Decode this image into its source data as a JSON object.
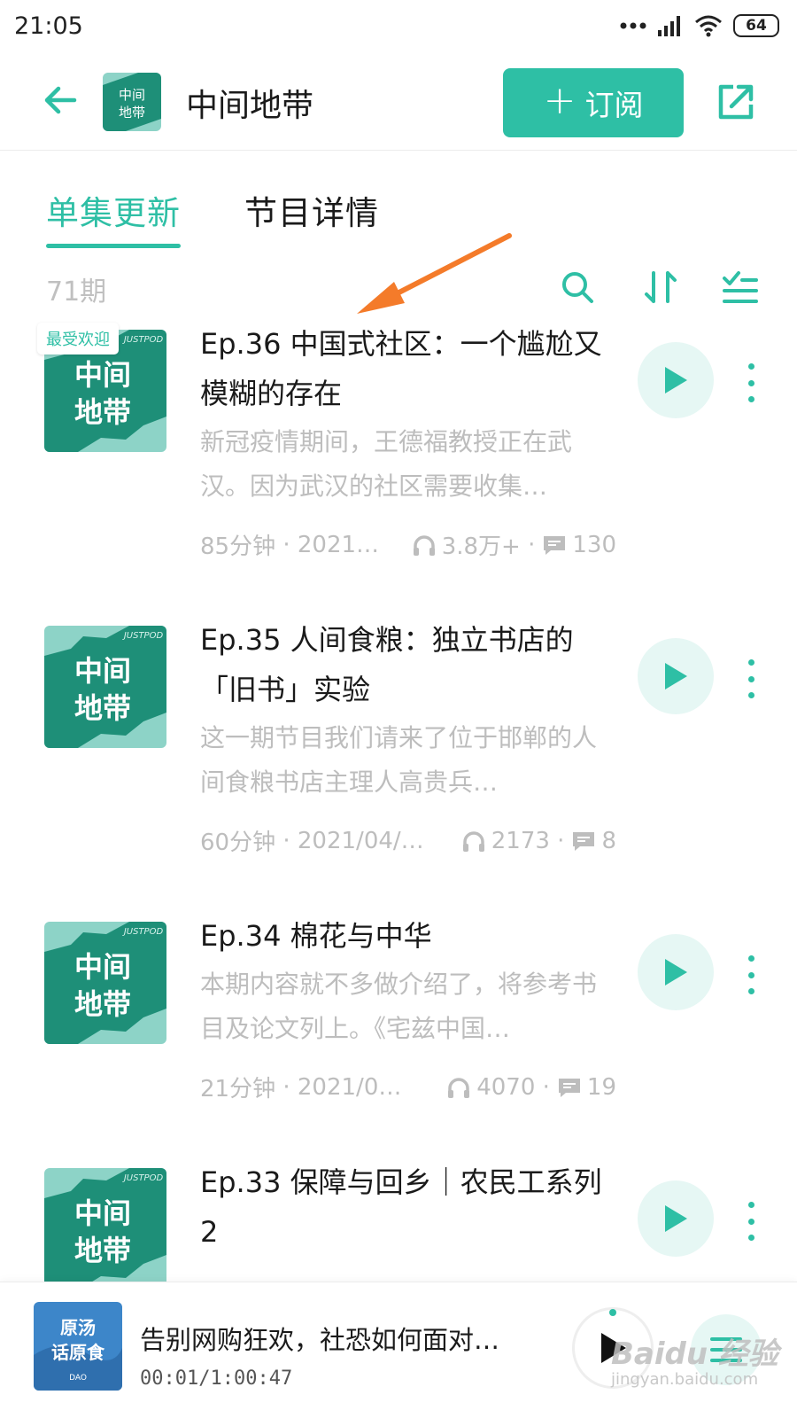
{
  "status_bar": {
    "time": "21:05",
    "battery": "64"
  },
  "header": {
    "title": "中间地带",
    "subscribe_label": "订阅",
    "cover_text_line1": "中间",
    "cover_text_line2": "地带"
  },
  "tabs": [
    {
      "label": "单集更新",
      "active": true
    },
    {
      "label": "节目详情",
      "active": false
    }
  ],
  "toolbar": {
    "episode_count": "71期"
  },
  "episodes": [
    {
      "badge": "最受欢迎",
      "title": "Ep.36 中国式社区：一个尴尬又模糊的存在",
      "description": "新冠疫情期间，王德福教授正在武汉。因为武汉的社区需要收集…",
      "duration": "85分钟",
      "date": "2021…",
      "plays": "3.8万+",
      "comments": "130"
    },
    {
      "badge": "",
      "title": "Ep.35 人间食粮：独立书店的「旧书」实验",
      "description": "这一期节目我们请来了位于邯郸的人间食粮书店主理人高贵兵…",
      "duration": "60分钟",
      "date": "2021/04/…",
      "plays": "2173",
      "comments": "8"
    },
    {
      "badge": "",
      "title": "Ep.34 棉花与中华",
      "description": "本期内容就不多做介绍了，将参考书目及论文列上。《宅兹中国…",
      "duration": "21分钟",
      "date": "2021/0…",
      "plays": "4070",
      "comments": "19"
    },
    {
      "badge": "",
      "title": "Ep.33 保障与回乡｜农民工系列2",
      "description": "",
      "duration": "",
      "date": "",
      "plays": "",
      "comments": ""
    }
  ],
  "cover_art": {
    "brand": "JUSTPOD",
    "line1": "中间",
    "line2": "地带"
  },
  "mini_player": {
    "title": "告别网购狂欢，社恐如何面对…",
    "time": "00:01/1:00:47",
    "cover_line1": "原汤",
    "cover_line2": "话原食",
    "cover_brand": "DAO"
  },
  "watermark": {
    "main": "Baidu 经验",
    "sub": "jingyan.baidu.com"
  },
  "colors": {
    "accent": "#2ebfa5",
    "accent_light": "#e6f7f4",
    "cover_dark": "#1e8f78",
    "cover_light": "#8dd3c7",
    "annotation": "#f47b2a"
  }
}
